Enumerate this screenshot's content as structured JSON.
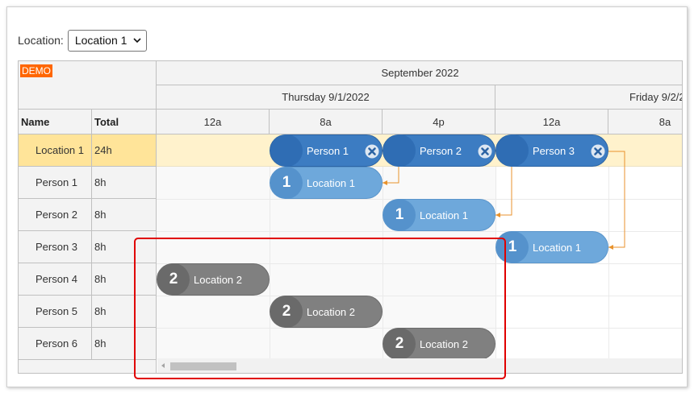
{
  "toolbar": {
    "location_label": "Location:",
    "location_selected": "Location 1"
  },
  "scheduler": {
    "demo_badge": "DEMO",
    "month_header": "September 2022",
    "day_headers": [
      "Thursday 9/1/2022",
      "Friday 9/2/2"
    ],
    "hour_headers": [
      "12a",
      "8a",
      "4p",
      "12a",
      "8a"
    ],
    "column_headers": {
      "name": "Name",
      "total": "Total"
    },
    "rows": [
      {
        "name": "Location 1",
        "total": "24h"
      },
      {
        "name": "Person 1",
        "total": "8h"
      },
      {
        "name": "Person 2",
        "total": "8h"
      },
      {
        "name": "Person 3",
        "total": "8h"
      },
      {
        "name": "Person 4",
        "total": "8h"
      },
      {
        "name": "Person 5",
        "total": "8h"
      },
      {
        "name": "Person 6",
        "total": "8h"
      }
    ],
    "events": [
      {
        "text": "Person 1"
      },
      {
        "text": "Person 2"
      },
      {
        "text": "Person 3"
      },
      {
        "number": "1",
        "text": "Location 1"
      },
      {
        "number": "1",
        "text": "Location 1"
      },
      {
        "number": "1",
        "text": "Location 1"
      },
      {
        "number": "2",
        "text": "Location 2"
      },
      {
        "number": "2",
        "text": "Location 2"
      },
      {
        "number": "2",
        "text": "Location 2"
      }
    ]
  },
  "colors": {
    "highlight_row": "#fff2cc",
    "highlight_row_header": "#ffe499",
    "event_blue_dark": "#3c7cc2",
    "event_blue_light": "#6ea8db",
    "event_gray": "#808080",
    "link_orange": "#e8922c",
    "annotation_red": "#e00000"
  }
}
